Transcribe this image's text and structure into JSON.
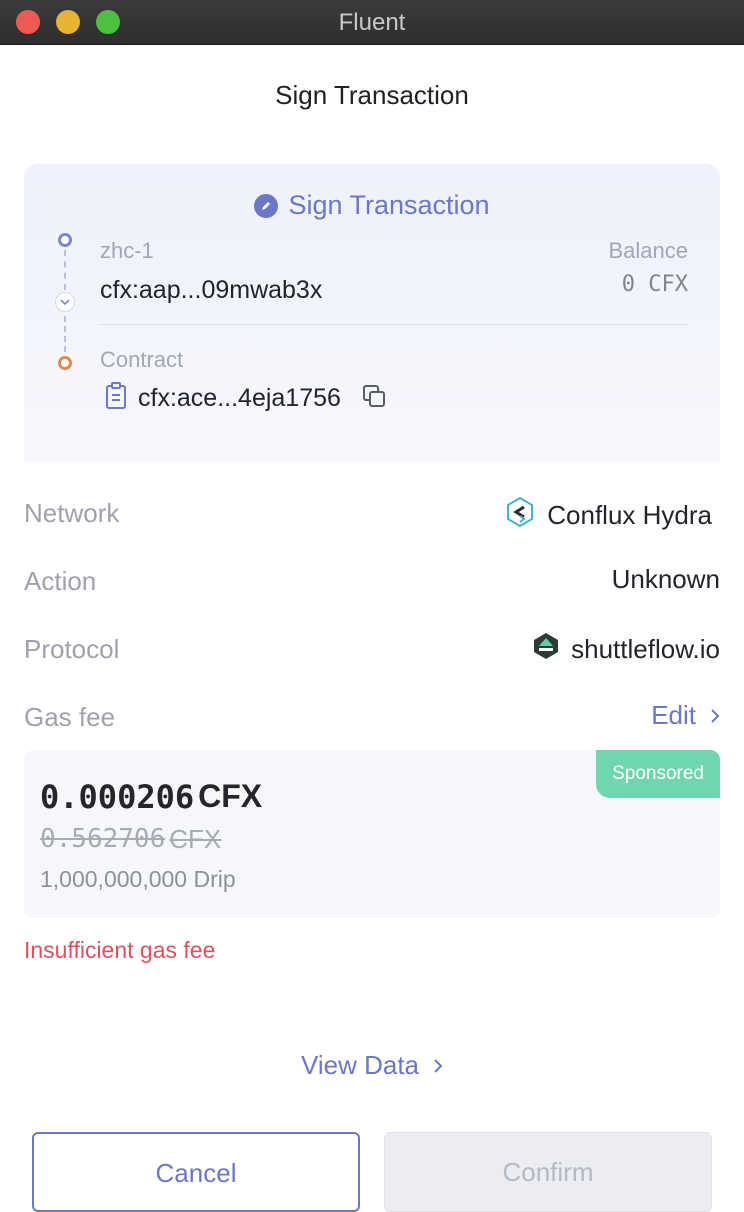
{
  "window": {
    "title": "Fluent"
  },
  "header": {
    "title": "Sign Transaction"
  },
  "sign_card": {
    "title": "Sign Transaction",
    "from_label": "zhc-1",
    "from_address": "cfx:aap...09mwab3x",
    "balance_label": "Balance",
    "balance_value": "0",
    "balance_unit": "CFX",
    "contract_label": "Contract",
    "contract_address": "cfx:ace...4eja1756"
  },
  "details": {
    "network_label": "Network",
    "network_value": "Conflux Hydra",
    "action_label": "Action",
    "action_value": "Unknown",
    "protocol_label": "Protocol",
    "protocol_value": "shuttleflow.io",
    "gas_label": "Gas fee",
    "edit_label": "Edit"
  },
  "gas": {
    "badge": "Sponsored",
    "amount": "0.000206",
    "amount_unit": "CFX",
    "original_amount": "0.562706",
    "original_unit": "CFX",
    "drip": "1,000,000,000 Drip"
  },
  "error": "Insufficient gas fee",
  "view_data": "View Data",
  "buttons": {
    "cancel": "Cancel",
    "confirm": "Confirm"
  },
  "colors": {
    "accent": "#6b78c9",
    "sponsored": "#6fd6b0",
    "error": "#e0505d",
    "contract_dot": "#e08a4c"
  }
}
